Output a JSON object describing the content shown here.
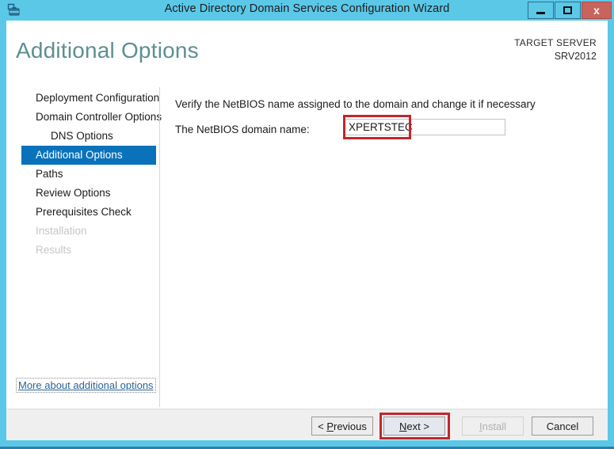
{
  "window": {
    "title": "Active Directory Domain Services Configuration Wizard",
    "icon": "server-directory-icon",
    "controls": {
      "minimize": "minimize-icon",
      "maximize": "maximize-icon",
      "close": "x"
    },
    "border_color": "#5bc8e8",
    "close_color": "#c9635e"
  },
  "header": {
    "page_title": "Additional Options",
    "target_server_label": "TARGET SERVER",
    "target_server_name": "SRV2012",
    "title_color": "#5d8f92"
  },
  "sidebar": {
    "selected_color": "#0a72ba",
    "items": [
      {
        "label": "Deployment Configuration",
        "state": "normal",
        "indent": false
      },
      {
        "label": "Domain Controller Options",
        "state": "normal",
        "indent": false
      },
      {
        "label": "DNS Options",
        "state": "normal",
        "indent": true
      },
      {
        "label": "Additional Options",
        "state": "selected",
        "indent": false
      },
      {
        "label": "Paths",
        "state": "normal",
        "indent": false
      },
      {
        "label": "Review Options",
        "state": "normal",
        "indent": false
      },
      {
        "label": "Prerequisites Check",
        "state": "normal",
        "indent": false
      },
      {
        "label": "Installation",
        "state": "disabled",
        "indent": false
      },
      {
        "label": "Results",
        "state": "disabled",
        "indent": false
      }
    ]
  },
  "content": {
    "instruction": "Verify the NetBIOS name assigned to the domain and change it if necessary",
    "field_label": "The NetBIOS domain name:",
    "netbios_value": "XPERTSTEC",
    "netbios_placeholder": "",
    "help_link": "More about additional options"
  },
  "footer": {
    "previous_label": "< Previous",
    "next_label": "Next >",
    "install_label": "Install",
    "cancel_label": "Cancel",
    "install_disabled": true
  },
  "annotations": {
    "color": "#c1272d",
    "targets": [
      "netbios-domain-name-input",
      "next-button"
    ]
  }
}
